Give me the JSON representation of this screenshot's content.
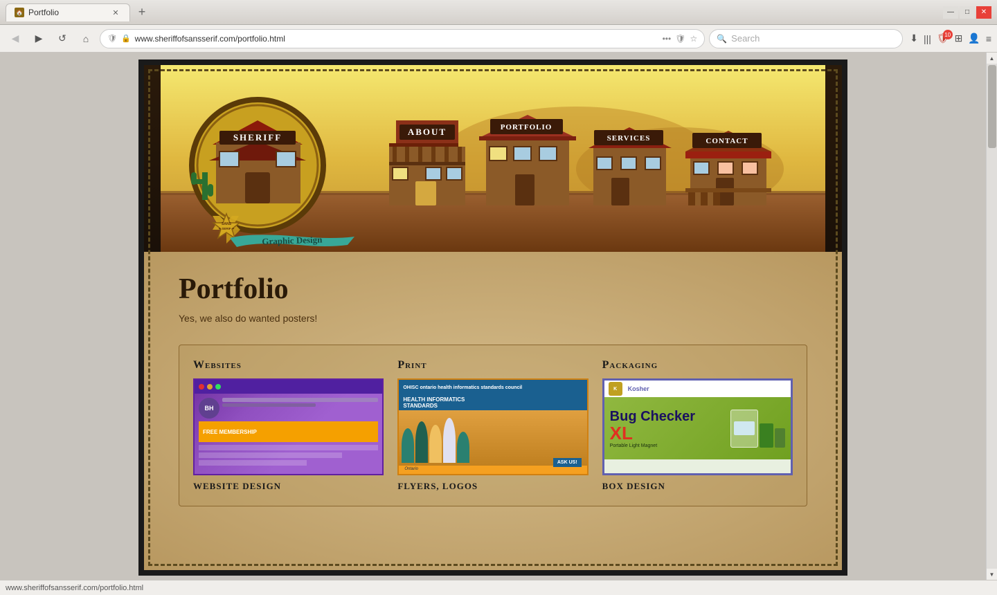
{
  "browser": {
    "tab_title": "Portfolio",
    "tab_favicon": "🏠",
    "new_tab_icon": "+",
    "window_controls": {
      "minimize": "—",
      "maximize": "□",
      "close": "✕"
    },
    "nav": {
      "back_icon": "◀",
      "forward_icon": "▶",
      "reload_icon": "↺",
      "home_icon": "⌂",
      "address": "www.sheriffofsansserif.com/portfolio.html",
      "more_icon": "•••",
      "shield_icon": "🛡",
      "star_icon": "☆",
      "search_placeholder": "Search",
      "download_icon": "⬇",
      "library_icon": "|||",
      "shield_badge": "10",
      "extensions_icon": "⊞",
      "profile_icon": "👤",
      "menu_icon": "≡"
    }
  },
  "status_bar": {
    "url": "www.sheriffofsansserif.com/portfolio.html"
  },
  "site": {
    "header": {
      "logo_text": "SHERIFF",
      "badge_line1": "SANS",
      "badge_line2": "✦",
      "badge_line3": "SERIF",
      "ribbon_text": "Graphic Design",
      "nav_items": [
        {
          "label": "ABOUT"
        },
        {
          "label": "PORTFOLIO"
        },
        {
          "label": "SERVICES"
        },
        {
          "label": "CONTACT"
        }
      ]
    },
    "body": {
      "page_title": "Portfolio",
      "page_subtitle": "Yes, we also do wanted posters!",
      "categories": [
        {
          "title": "Websites",
          "subtitle": "Website design",
          "image_alt": "Website design screenshot"
        },
        {
          "title": "Print",
          "subtitle": "Flyers, Logos",
          "image_alt": "Print design - OHISC health informatics"
        },
        {
          "title": "Packaging",
          "subtitle": "Box design",
          "image_alt": "Bug Checker XL packaging"
        }
      ]
    }
  }
}
